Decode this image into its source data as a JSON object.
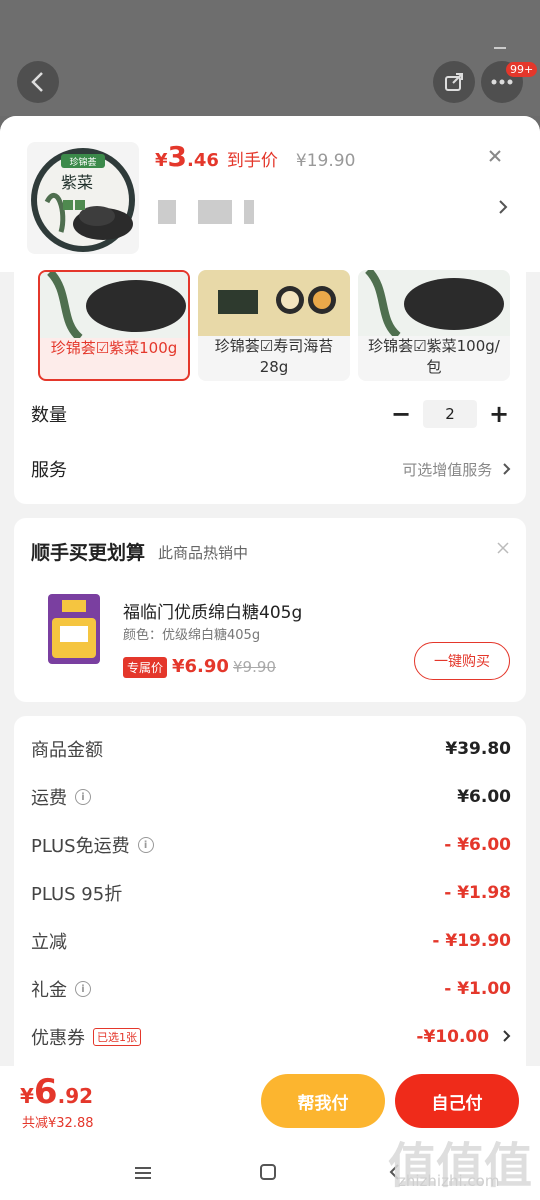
{
  "topbar": {
    "badge": "99+",
    "back_icon": "chevron-left-icon",
    "share_icon": "share-icon",
    "more_icon": "more-dots-icon"
  },
  "product": {
    "thumb_brand": "珍锦荟",
    "thumb_name": "紫菜",
    "price_symbol": "¥",
    "price_int": "3",
    "price_dec": ".46",
    "price_tag": "到手价",
    "original_price": "¥19.90"
  },
  "variants": [
    {
      "label": "珍锦荟☑紫菜100g",
      "selected": true
    },
    {
      "label": "珍锦荟☑寿司海苔28g",
      "selected": false
    },
    {
      "label": "珍锦荟☑紫菜100g/包",
      "selected": false
    }
  ],
  "quantity": {
    "label": "数量",
    "value": "2",
    "minus": "−",
    "plus": "+"
  },
  "service": {
    "label": "服务",
    "value": "可选增值服务"
  },
  "addon": {
    "title": "顺手买更划算",
    "subtitle": "此商品热销中",
    "product_name": "福临门优质绵白糖405g",
    "spec": "颜色：优级绵白糖405g",
    "exclusive_tag": "专属价",
    "exclusive_price": "¥6.90",
    "original_price": "¥9.90",
    "buy_label": "一键购买"
  },
  "fees": [
    {
      "label": "商品金额",
      "value": "¥39.80",
      "info": false,
      "red": false
    },
    {
      "label": "运费",
      "value": "¥6.00",
      "info": true,
      "red": false
    },
    {
      "label": "PLUS免运费",
      "value": "- ¥6.00",
      "info": true,
      "red": true
    },
    {
      "label": "PLUS 95折",
      "value": "- ¥1.98",
      "info": false,
      "red": true
    },
    {
      "label": "立减",
      "value": "- ¥19.90",
      "info": false,
      "red": true
    },
    {
      "label": "礼金",
      "value": "- ¥1.00",
      "info": true,
      "red": true
    },
    {
      "label": "优惠券",
      "value": "-¥10.00",
      "info": false,
      "red": true,
      "tag": "已选1张"
    }
  ],
  "bottom": {
    "total_symbol": "¥",
    "total_int": "6",
    "total_dec": ".92",
    "saved": "共减¥32.88",
    "help_pay": "帮我付",
    "self_pay": "自己付"
  },
  "watermark": {
    "text": "值值值",
    "url": "zhizhizhi.com"
  },
  "colors": {
    "accent": "#e4372b",
    "help_pay": "#fcb52f",
    "self_pay": "#ef2b1a"
  }
}
